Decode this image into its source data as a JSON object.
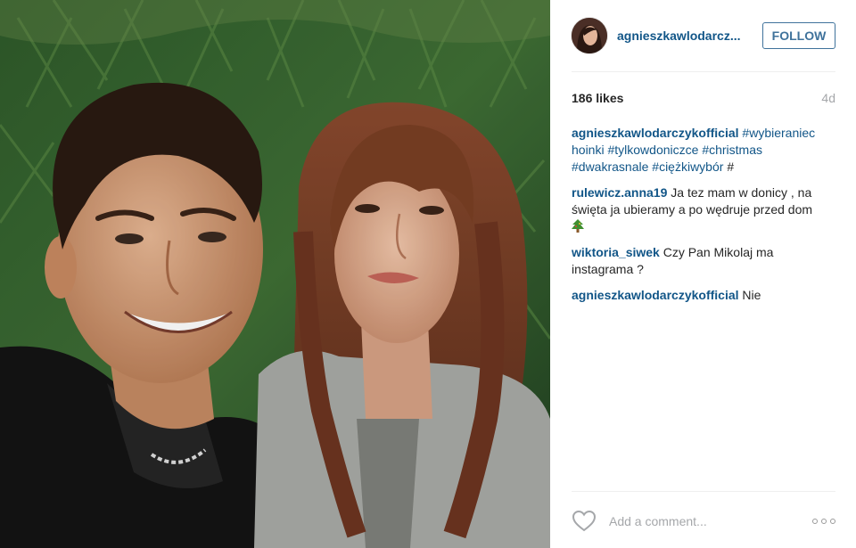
{
  "header": {
    "username": "agnieszkawlodarcz...",
    "follow_label": "FOLLOW"
  },
  "stats": {
    "likes": "186 likes",
    "age": "4d"
  },
  "caption": {
    "author": "agnieszkawlodarczykofficial",
    "tags": [
      "#wybieraniec hoinki",
      "#tylkowdoniczce",
      "#christmas",
      "#dwakrasnale",
      "#ciężkiwybór",
      "#"
    ]
  },
  "comments": [
    {
      "author": "rulewicz.anna19",
      "text": "Ja tez mam w donicy , na święta ja ubieramy a po wędruje przed dom",
      "emoji": "christmas-tree-icon"
    },
    {
      "author": "wiktoria_siwek",
      "text": "Czy Pan Mikolaj ma instagrama ?"
    },
    {
      "author": "agnieszkawlodarczykofficial",
      "text": "Nie"
    }
  ],
  "footer": {
    "comment_placeholder": "Add a comment..."
  },
  "colors": {
    "link": "#125688",
    "follow": "#3f729b",
    "muted": "#a5a7aa"
  },
  "icons": [
    "heart-icon",
    "more-options-icon",
    "christmas-tree-icon"
  ]
}
